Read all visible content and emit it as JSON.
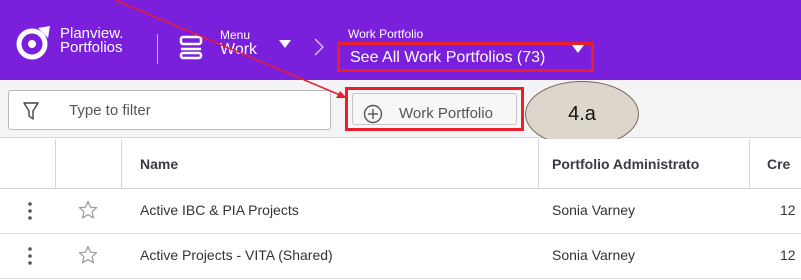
{
  "header": {
    "brand_line1": "Planview.",
    "brand_line2": "Portfolios",
    "menu_small": "Menu",
    "menu_main": "Work",
    "portfolio_small": "Work Portfolio",
    "portfolio_selected": "See All Work Portfolios (73)",
    "bg_color": "#7a1fdc"
  },
  "toolbar": {
    "filter_placeholder": "Type to filter",
    "add_button_label": "Work Portfolio",
    "callout_label": "4.a",
    "highlight_color": "#e8202a"
  },
  "table": {
    "columns": [
      "Name",
      "Portfolio Administrato",
      "Cre"
    ],
    "rows": [
      {
        "name": "Active IBC & PIA Projects",
        "admin": "Sonia Varney",
        "created": "12"
      },
      {
        "name": "Active Projects - VITA (Shared)",
        "admin": "Sonia Varney",
        "created": "12"
      }
    ]
  },
  "icons": [
    "planview-logo-icon",
    "menu-icon",
    "chevron-down-icon",
    "chevron-right-icon",
    "filter-icon",
    "plus-circle-icon",
    "kebab-menu-icon",
    "star-icon"
  ]
}
